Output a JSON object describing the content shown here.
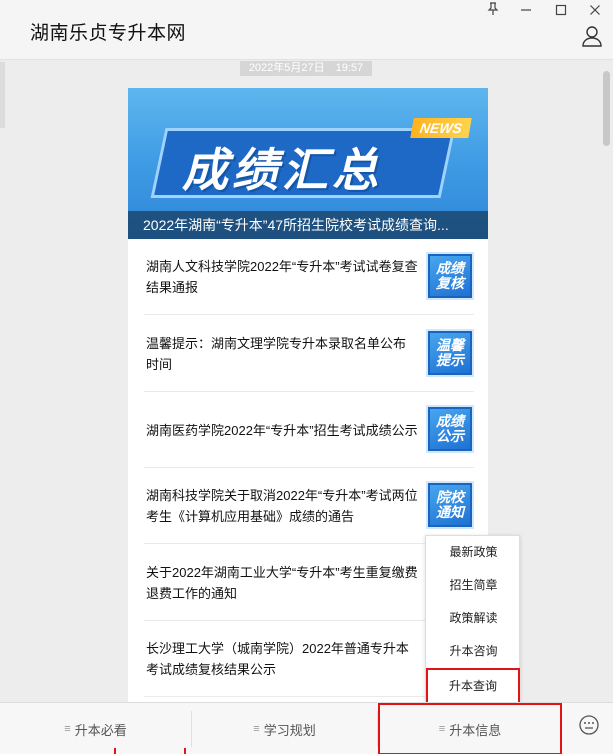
{
  "window": {
    "title": "湖南乐贞专升本网",
    "controls": {
      "pin": "pin-icon",
      "minimize": "minimize-icon",
      "maximize": "maximize-icon",
      "close": "close-icon"
    }
  },
  "timestamp": "2022年5月27日　19:57",
  "banner": {
    "title": "成绩汇总",
    "badge": "NEWS",
    "caption": "2022年湖南“专升本”47所招生院校考试成绩查询..."
  },
  "articles": [
    {
      "title": "湖南人文科技学院2022年“专升本”考试试卷复查结果通报",
      "thumb_text": "成绩复核"
    },
    {
      "title": "温馨提示：湖南文理学院专升本录取名单公布时间",
      "thumb_text": "温馨提示"
    },
    {
      "title": "湖南医药学院2022年“专升本”招生考试成绩公示",
      "thumb_text": "成绩公示"
    },
    {
      "title": "湖南科技学院关于取消2022年“专升本”考试两位考生《计算机应用基础》成绩的通告",
      "thumb_text": "院校通知"
    },
    {
      "title": "关于2022年湖南工业大学“专升本”考生重复缴费退费工作的通知",
      "thumb_text": ""
    },
    {
      "title": "长沙理工大学（城南学院）2022年普通专升本考试成绩复核结果公示",
      "thumb_text": ""
    }
  ],
  "popup_menu": [
    "最新政策",
    "招生简章",
    "政策解读",
    "升本咨询",
    "升本查询"
  ],
  "bottom_tabs": [
    "升本必看",
    "学习规划",
    "升本信息"
  ],
  "menu_glyph": "≡",
  "colors": {
    "accent_red": "#e01414",
    "banner_blue": "#2f86d8"
  }
}
